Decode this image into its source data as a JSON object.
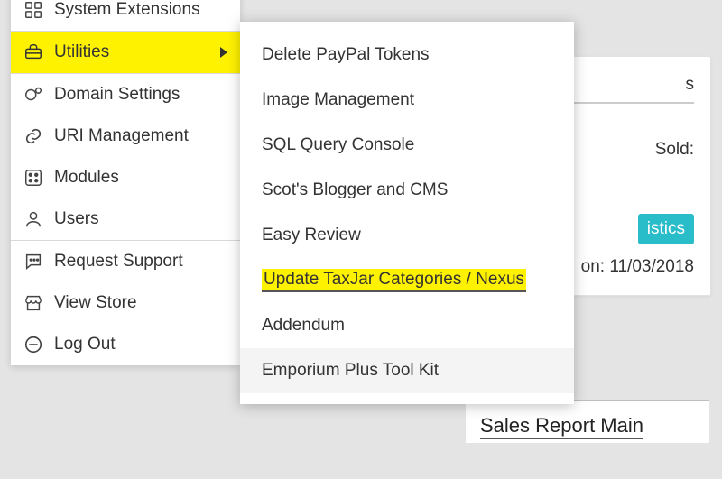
{
  "sidebar": {
    "group0": [
      {
        "label": "System Extensions",
        "icon": "grid-icon"
      }
    ],
    "utilities_label": "Utilities",
    "group2": [
      {
        "label": "Domain Settings"
      },
      {
        "label": "URI Management"
      },
      {
        "label": "Modules"
      },
      {
        "label": "Users"
      }
    ],
    "group3": [
      {
        "label": "Request Support"
      },
      {
        "label": "View Store"
      },
      {
        "label": "Log Out"
      }
    ]
  },
  "submenu": {
    "items": [
      "Delete PayPal Tokens",
      "Image Management",
      "SQL Query Console",
      "Scot's Blogger and CMS",
      "Easy Review",
      "Update TaxJar Categories / Nexus",
      "Addendum",
      "Emporium Plus Tool Kit"
    ]
  },
  "right": {
    "header_stub": "s",
    "sold_stub": "Sold:",
    "stat_btn": "istics",
    "on_label": "on: 11/03/2018",
    "sales_report": "Sales Report Main"
  }
}
